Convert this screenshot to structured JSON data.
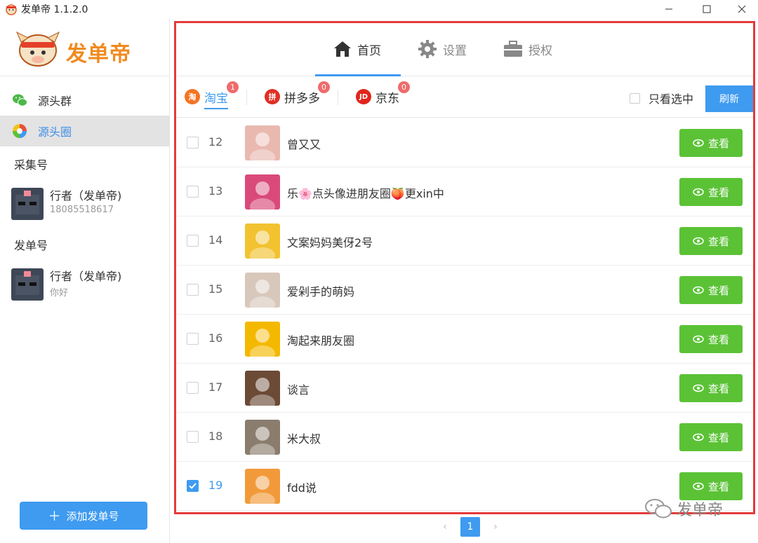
{
  "window": {
    "title": "发单帝 1.1.2.0"
  },
  "sidebar": {
    "logo_text": "发单帝",
    "items": [
      {
        "label": "源头群",
        "icon": "wechat-icon"
      },
      {
        "label": "源头圈",
        "icon": "moments-icon",
        "active": true
      }
    ],
    "collect_title": "采集号",
    "collect_account": {
      "name": "行者（发单帝)",
      "sub": "18085518617"
    },
    "send_title": "发单号",
    "send_account": {
      "name": "行者（发单帝)",
      "sub": "你好"
    },
    "add_button": "添加发单号"
  },
  "nav": {
    "tabs": [
      {
        "label": "首页",
        "icon": "home-icon",
        "active": true
      },
      {
        "label": "设置",
        "icon": "gear-icon"
      },
      {
        "label": "授权",
        "icon": "briefcase-icon"
      }
    ]
  },
  "platforms": [
    {
      "label": "淘宝",
      "badge": "1",
      "icon_text": "淘",
      "color": "#f57322",
      "active": true
    },
    {
      "label": "拼多多",
      "badge": "0",
      "icon_text": "拼",
      "color": "#e02e24"
    },
    {
      "label": "京东",
      "badge": "0",
      "icon_text": "JD",
      "color": "#e1251b"
    }
  ],
  "filter": {
    "only_selected": "只看选中",
    "refresh": "刷新"
  },
  "rows": [
    {
      "num": "12",
      "name": "曾又又",
      "checked": false,
      "avatar_color": "#e9b9b0"
    },
    {
      "num": "13",
      "name": "乐🌸点头像进朋友圈🍑更xin中",
      "checked": false,
      "avatar_color": "#d94a7a"
    },
    {
      "num": "14",
      "name": "文案妈妈美伢2号",
      "checked": false,
      "avatar_color": "#f2c230"
    },
    {
      "num": "15",
      "name": "爱剁手的萌妈",
      "checked": false,
      "avatar_color": "#d8c8bc"
    },
    {
      "num": "16",
      "name": "淘起来朋友圈",
      "checked": false,
      "avatar_color": "#f5b800"
    },
    {
      "num": "17",
      "name": "谈言",
      "checked": false,
      "avatar_color": "#6b4a36"
    },
    {
      "num": "18",
      "name": "米大叔",
      "checked": false,
      "avatar_color": "#8b7d6e"
    },
    {
      "num": "19",
      "name": "fdd说",
      "checked": true,
      "avatar_color": "#f29a3a"
    }
  ],
  "view_label": "查看",
  "pagination": {
    "prev": "‹",
    "current": "1",
    "next": "›"
  },
  "watermark": "发单帝",
  "colors": {
    "accent": "#3e9bf0",
    "green": "#5bc236",
    "highlight_border": "#e53a3a"
  }
}
